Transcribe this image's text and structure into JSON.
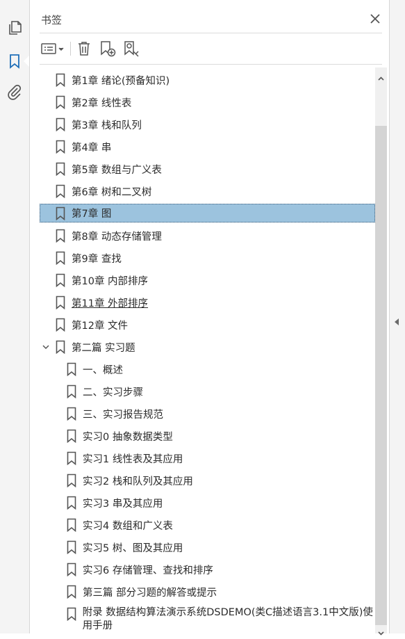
{
  "panel": {
    "title": "书签",
    "toolbar": {
      "options_icon": "options-list-icon",
      "delete_icon": "trash-icon",
      "new_bookmark_icon": "new-bookmark-icon",
      "bookmark_from_structure_icon": "bookmark-search-icon"
    }
  },
  "left_rail": {
    "items": [
      "pages-icon",
      "bookmark-icon",
      "attachment-icon"
    ]
  },
  "colors": {
    "selected_bg": "#9cc3de",
    "bookmark_stroke": "#555555"
  },
  "bookmarks": [
    {
      "label": "第1章 绪论(预备知识)",
      "level": 1
    },
    {
      "label": "第2章 线性表",
      "level": 1
    },
    {
      "label": "第3章 栈和队列",
      "level": 1
    },
    {
      "label": "第4章 串",
      "level": 1
    },
    {
      "label": "第5章 数组与广义表",
      "level": 1
    },
    {
      "label": "第6章 树和二叉树",
      "level": 1
    },
    {
      "label": "第7章 图",
      "level": 1
    },
    {
      "label": "第8章 动态存储管理",
      "level": 1
    },
    {
      "label": "第9章 查找",
      "level": 1
    },
    {
      "label": "第10章 内部排序",
      "level": 1
    },
    {
      "label": "第11章 外部排序",
      "level": 1
    },
    {
      "label": "第12章 文件",
      "level": 1
    },
    {
      "label": "第二篇 实习题",
      "level": 1
    },
    {
      "label": "一、概述",
      "level": 2
    },
    {
      "label": "二、实习步骤",
      "level": 2
    },
    {
      "label": "三、实习报告规范",
      "level": 2
    },
    {
      "label": "实习0 抽象数据类型",
      "level": 2
    },
    {
      "label": "实习1 线性表及其应用",
      "level": 2
    },
    {
      "label": "实习2 栈和队列及其应用",
      "level": 2
    },
    {
      "label": "实习3 串及其应用",
      "level": 2
    },
    {
      "label": "实习4 数组和广义表",
      "level": 2
    },
    {
      "label": "实习5 树、图及其应用",
      "level": 2
    },
    {
      "label": "实习6 存储管理、查找和排序",
      "level": 2
    },
    {
      "label": "第三篇 部分习题的解答或提示",
      "level": 2
    },
    {
      "label": "附录 数据结构算法演示系统DSDEMO(类C描述语言3.1中文版)使用手册",
      "level": 2
    }
  ]
}
